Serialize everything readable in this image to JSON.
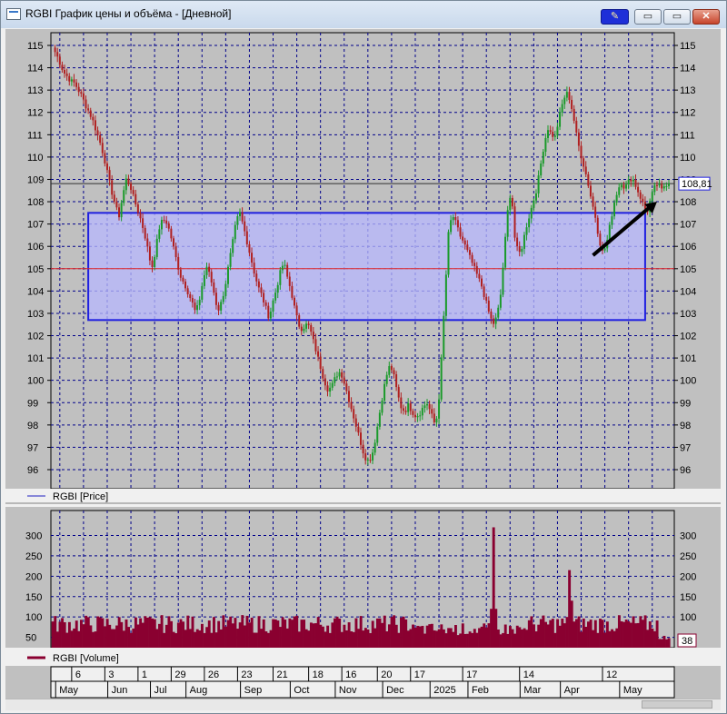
{
  "window": {
    "title": "RGBI График цены и объёма - [Дневной]",
    "buttons": {
      "min": "▭",
      "max": "▭",
      "close": "✕",
      "pin": "✎"
    }
  },
  "colors": {
    "up": "#1a9a2a",
    "down": "#b02020",
    "volume": "#8a0030",
    "box_fill": "#b8b8ff",
    "box_stroke": "#2020e0",
    "support": "#e02020",
    "grid": "#00008b"
  },
  "chart_data": [
    {
      "type": "candlestick",
      "legend": "RGBI [Price]",
      "ylim": [
        96,
        115
      ],
      "yticks": [
        96,
        97,
        98,
        99,
        100,
        101,
        102,
        103,
        104,
        105,
        106,
        107,
        108,
        109,
        110,
        111,
        112,
        113,
        114,
        115
      ],
      "last_value_label": "108,81",
      "last_value": 108.81,
      "annotations": {
        "range_box": {
          "start_index": 15,
          "end_index": 250,
          "low": 102.7,
          "high": 107.5
        },
        "support_line": 105.0,
        "arrow": {
          "from": {
            "index": 228,
            "value": 105.6
          },
          "to": {
            "index": 255,
            "value": 108.0
          }
        }
      },
      "closes": [
        114.9,
        114.6,
        114.2,
        113.8,
        113.6,
        113.4,
        113.3,
        113.0,
        112.7,
        112.3,
        112.0,
        111.6,
        111.1,
        110.6,
        110.0,
        109.2,
        108.5,
        107.9,
        107.3,
        108.2,
        109.0,
        108.8,
        108.2,
        107.7,
        107.2,
        106.6,
        105.8,
        105.0,
        105.8,
        106.8,
        107.2,
        107.1,
        106.6,
        105.9,
        105.2,
        104.6,
        104.3,
        103.9,
        103.5,
        103.0,
        103.6,
        104.5,
        105.1,
        104.6,
        103.9,
        103.1,
        103.5,
        104.2,
        105.2,
        106.1,
        107.1,
        107.5,
        106.9,
        106.2,
        105.5,
        104.8,
        104.2,
        103.8,
        103.3,
        102.8,
        103.5,
        104.1,
        104.8,
        105.3,
        104.6,
        104.0,
        103.2,
        102.5,
        102.3,
        102.5,
        102.4,
        101.8,
        101.2,
        100.6,
        100.0,
        99.6,
        99.7,
        100.1,
        100.4,
        100.2,
        99.6,
        99.0,
        98.4,
        97.8,
        97.2,
        96.6,
        96.4,
        96.6,
        97.4,
        98.4,
        99.4,
        100.2,
        100.7,
        100.2,
        99.4,
        98.8,
        98.6,
        98.9,
        98.6,
        98.4,
        98.5,
        98.8,
        99.0,
        98.6,
        98.1,
        98.4,
        101.0,
        104.0,
        106.8,
        107.4,
        107.0,
        106.5,
        106.2,
        105.8,
        105.4,
        105.0,
        104.6,
        104.2,
        103.6,
        103.0,
        102.5,
        102.8,
        103.6,
        105.5,
        107.5,
        108.6,
        106.4,
        105.6,
        106.0,
        106.8,
        107.4,
        108.0,
        108.6,
        109.6,
        110.6,
        111.3,
        111.0,
        110.9,
        111.7,
        112.4,
        112.9,
        112.6,
        111.8,
        110.8,
        110.1,
        109.5,
        108.8,
        108.0,
        107.3,
        106.3,
        105.7,
        106.1,
        107.0,
        107.9,
        108.5,
        108.9,
        108.6,
        108.9,
        109.1,
        108.7,
        108.3,
        107.9,
        107.5,
        108.1,
        108.6,
        108.8,
        108.5,
        108.8,
        108.81
      ],
      "volume": {
        "legend": "RGBI [Volume]",
        "ylim": [
          38,
          330
        ],
        "yticks": [
          50,
          100,
          150,
          200,
          250,
          300
        ],
        "last_value_label": "38",
        "last_value": 38
      },
      "x_day_labels": [
        "6",
        "3",
        "1",
        "29",
        "26",
        "23",
        "21",
        "18",
        "16",
        "20",
        "17",
        "17",
        "14",
        "12"
      ],
      "x_month_labels": [
        "May",
        "Jun",
        "Jul",
        "Aug",
        "Sep",
        "Oct",
        "Nov",
        "Dec",
        "2025",
        "Feb",
        "Mar",
        "Apr",
        "May"
      ]
    }
  ]
}
